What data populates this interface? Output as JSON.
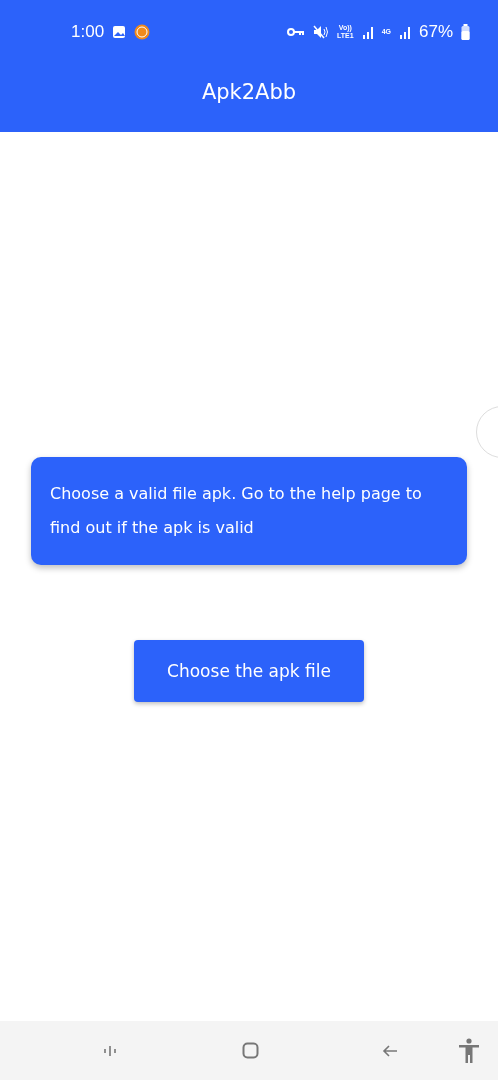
{
  "status_bar": {
    "time": "1:00",
    "volte": "Vo))",
    "lte": "LTE1",
    "network": "4G",
    "battery": "67%"
  },
  "app_bar": {
    "title": "Apk2Abb"
  },
  "message": "Choose a valid file apk. Go to the help page to find out if the apk is valid",
  "button": "Choose the apk file"
}
